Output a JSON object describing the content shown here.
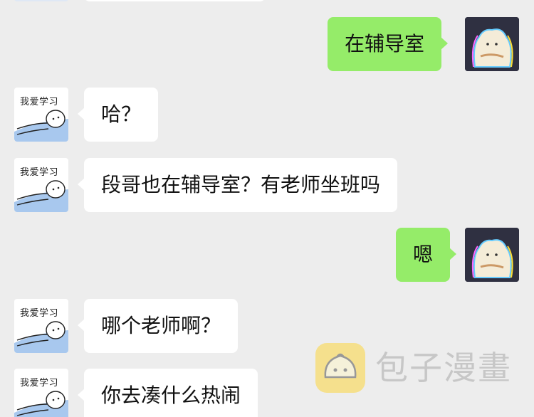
{
  "contact_avatar": {
    "caption": "我爱学习"
  },
  "messages": [
    {
      "side": "right",
      "text": "在辅导室"
    },
    {
      "side": "left",
      "text": "哈？"
    },
    {
      "side": "left",
      "text": "段哥也在辅导室？有老师坐班吗"
    },
    {
      "side": "right",
      "text": "嗯"
    },
    {
      "side": "left",
      "text": "哪个老师啊？"
    },
    {
      "side": "left",
      "text": "你去凑什么热闹"
    }
  ],
  "watermark": {
    "text": "包子漫畫"
  },
  "colors": {
    "background": "#ededed",
    "self_bubble": "#95ec69",
    "other_bubble": "#ffffff",
    "watermark_icon": "#ffd21a"
  }
}
